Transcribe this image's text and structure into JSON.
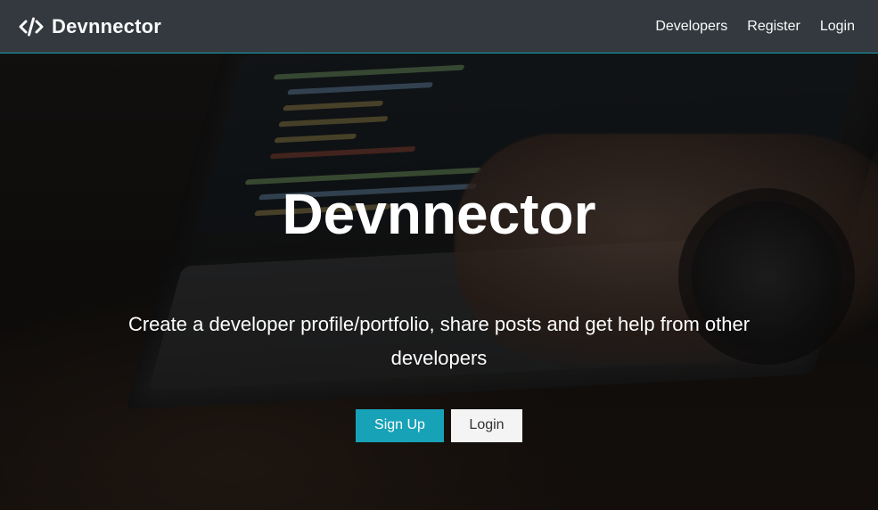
{
  "navbar": {
    "brand": "Devnnector",
    "links": [
      "Developers",
      "Register",
      "Login"
    ]
  },
  "landing": {
    "title": "Devnnector",
    "lead": "Create a developer profile/portfolio, share posts and get help from other developers",
    "buttons": {
      "signup": "Sign Up",
      "login": "Login"
    }
  },
  "icons": {
    "brand_icon": "code-icon"
  },
  "colors": {
    "navbar_bg": "#343a40",
    "primary": "#17a2b8",
    "light_button_bg": "#f4f4f4",
    "text_on_dark": "#ffffff"
  }
}
